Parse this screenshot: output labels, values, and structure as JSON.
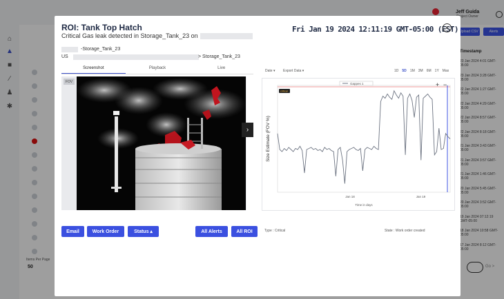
{
  "background": {
    "user": {
      "name": "Jeff Guida",
      "role": "Project Owner"
    },
    "upload_csv_label": "Upload CSV",
    "alerts_label": "Alerts",
    "column_header": "Timestamp",
    "timestamps": [
      "23 Jan 2024 4:01 GMT-05:00",
      "23 Jan 2024 3:28 GMT-05:00",
      "22 Jan 2024 1:27 GMT-05:00",
      "22 Jan 2024 4:29 GMT-05:00",
      "22 Jan 2024 8:57 GMT-05:00",
      "22 Jan 2024 8:18 GMT-05:00",
      "21 Jan 2024 3:43 GMT-05:00",
      "21 Jan 2024 3:57 GMT-05:00",
      "21 Jan 2024 1:46 GMT-05:00",
      "20 Jan 2024 5:45 GMT-05:00",
      "20 Jan 2024 3:52 GMT-05:00",
      "19 Jan 2024 07:12:19 GMT-05:00",
      "18 Jan 2024 10:58 GMT-05:00",
      "17 Jan 2024 8:12 GMT-05:00"
    ],
    "rows_per_page_label": "Items Per Page",
    "rows_per_page_value": "50",
    "pager_next": "Go >"
  },
  "modal": {
    "title": "ROI: Tank Top Hatch",
    "subtitle": "Critical Gas leak detected in Storage_Tank_23 on",
    "datetime": "Fri Jan 19 2024 12:11:19 GMT-05:00 (EST)",
    "close_glyph": "✕",
    "location_line1": "-Storage_Tank_23",
    "location_line2_prefix": "US",
    "location_line2_suffix": "> Storage_Tank_23",
    "tabs": [
      {
        "label": "Screenshot",
        "active": true
      },
      {
        "label": "Playback",
        "active": false
      },
      {
        "label": "Live",
        "active": false
      }
    ],
    "image_label": "FOV",
    "next_glyph": "›",
    "buttons": {
      "email": "Email",
      "work_order": "Work Order",
      "status": "Status ▴",
      "all_alerts": "All Alerts",
      "all_roi": "All ROI"
    },
    "type_text": "Type : Critical",
    "state_text": "State : Work order created"
  },
  "chart_controls": {
    "zoom_label": "Date ▾",
    "export_label": "Export Data ▾",
    "ranges": [
      "1D",
      "5D",
      "1M",
      "3M",
      "6M",
      "1Y",
      "Max"
    ],
    "active_range": "5D"
  },
  "chart_data": {
    "type": "line",
    "series": [
      {
        "name": "Gappes 1",
        "color": "#6b7280"
      }
    ],
    "ylabel": "Size Estimate (FOV %)",
    "xlabel": "Time in days",
    "x_tick_labels": [
      "Jan 18",
      "Jan 19"
    ],
    "threshold_label": "critical",
    "threshold_color": "#ef9a9a",
    "cursor_color": "#3b50e0",
    "values": [
      55,
      40,
      38,
      41,
      39,
      42,
      40,
      38,
      41,
      40,
      43,
      39,
      18,
      40,
      41,
      42,
      40,
      41,
      39,
      40,
      38,
      42,
      40,
      41,
      39,
      38,
      15,
      40,
      42,
      30,
      8,
      38,
      40,
      41,
      42,
      40,
      39,
      41,
      20,
      40,
      42,
      41,
      40,
      43,
      41,
      40,
      85,
      90,
      88,
      92,
      89,
      87,
      95,
      91,
      88,
      93,
      90,
      35,
      88,
      92,
      86,
      70,
      89,
      91,
      30,
      88,
      90,
      92,
      89,
      87,
      35,
      38,
      60,
      40,
      41,
      55,
      52,
      50
    ]
  }
}
